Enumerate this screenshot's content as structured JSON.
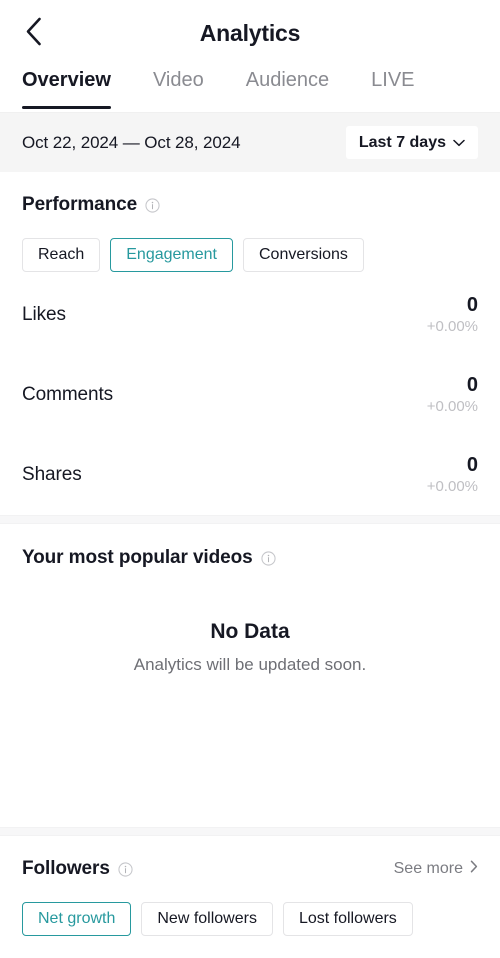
{
  "header": {
    "title": "Analytics",
    "back_icon": "chevron-left-icon"
  },
  "tabs": [
    {
      "label": "Overview",
      "active": true
    },
    {
      "label": "Video",
      "active": false
    },
    {
      "label": "Audience",
      "active": false
    },
    {
      "label": "LIVE",
      "active": false
    }
  ],
  "date_bar": {
    "range_text": "Oct 22, 2024 — Oct 28, 2024",
    "selected_preset": "Last 7 days",
    "chevron_icon": "chevron-down-icon"
  },
  "performance": {
    "title": "Performance",
    "info_icon": "info-circle-icon",
    "chips": [
      {
        "label": "Reach",
        "selected": false
      },
      {
        "label": "Engagement",
        "selected": true
      },
      {
        "label": "Conversions",
        "selected": false
      }
    ],
    "metrics": [
      {
        "name": "Likes",
        "value": "0",
        "delta": "+0.00%"
      },
      {
        "name": "Comments",
        "value": "0",
        "delta": "+0.00%"
      },
      {
        "name": "Shares",
        "value": "0",
        "delta": "+0.00%"
      }
    ]
  },
  "popular_videos": {
    "title": "Your most popular videos",
    "info_icon": "info-circle-icon",
    "empty_title": "No Data",
    "empty_subtitle": "Analytics will be updated soon."
  },
  "followers": {
    "title": "Followers",
    "info_icon": "info-circle-icon",
    "see_more_label": "See more",
    "see_more_icon": "chevron-right-icon",
    "chips": [
      {
        "label": "Net growth",
        "selected": true
      },
      {
        "label": "New followers",
        "selected": false
      },
      {
        "label": "Lost followers",
        "selected": false
      }
    ]
  },
  "colors": {
    "accent_teal": "#27999e",
    "text_primary": "#161823",
    "text_muted": "#8a8b91",
    "bar_bg": "#f5f5f5"
  }
}
